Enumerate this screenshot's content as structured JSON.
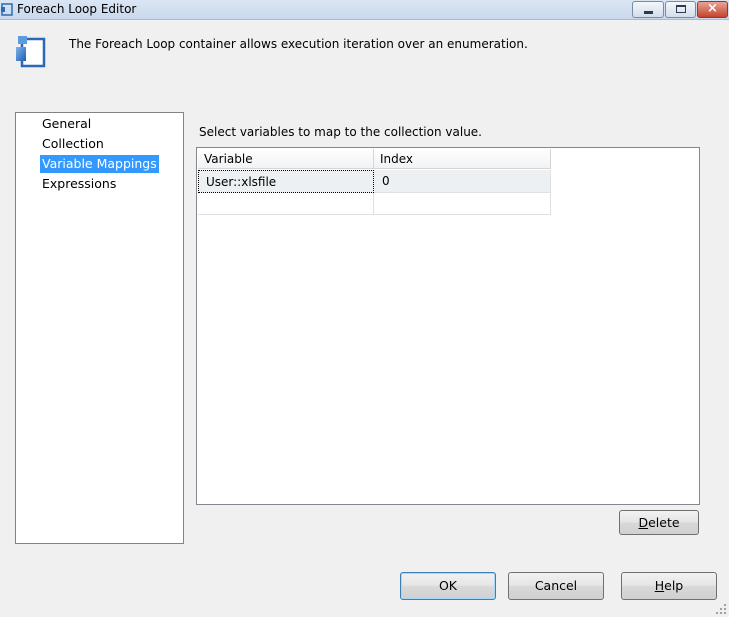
{
  "window": {
    "title": "Foreach Loop Editor",
    "close_glyph": "×"
  },
  "header": {
    "icon": "foreach-loop-icon",
    "description": "The Foreach Loop container allows execution iteration over an enumeration."
  },
  "nav": {
    "items": [
      {
        "label": "General",
        "selected": false
      },
      {
        "label": "Collection",
        "selected": false
      },
      {
        "label": "Variable Mappings",
        "selected": true
      },
      {
        "label": "Expressions",
        "selected": false
      }
    ]
  },
  "mappings": {
    "caption": "Select variables to map to the collection value.",
    "columns": [
      "Variable",
      "Index"
    ],
    "rows": [
      {
        "variable": "User::xlsfile",
        "index": "0"
      }
    ]
  },
  "buttons": {
    "delete": {
      "mnemonic": "D",
      "rest": "elete"
    },
    "ok": "OK",
    "cancel": "Cancel",
    "help": {
      "mnemonic": "H",
      "rest": "elp"
    }
  },
  "colors": {
    "selection": "#3399ff",
    "titlebar": "#dbe6f4",
    "close_button": "#c4442e"
  }
}
